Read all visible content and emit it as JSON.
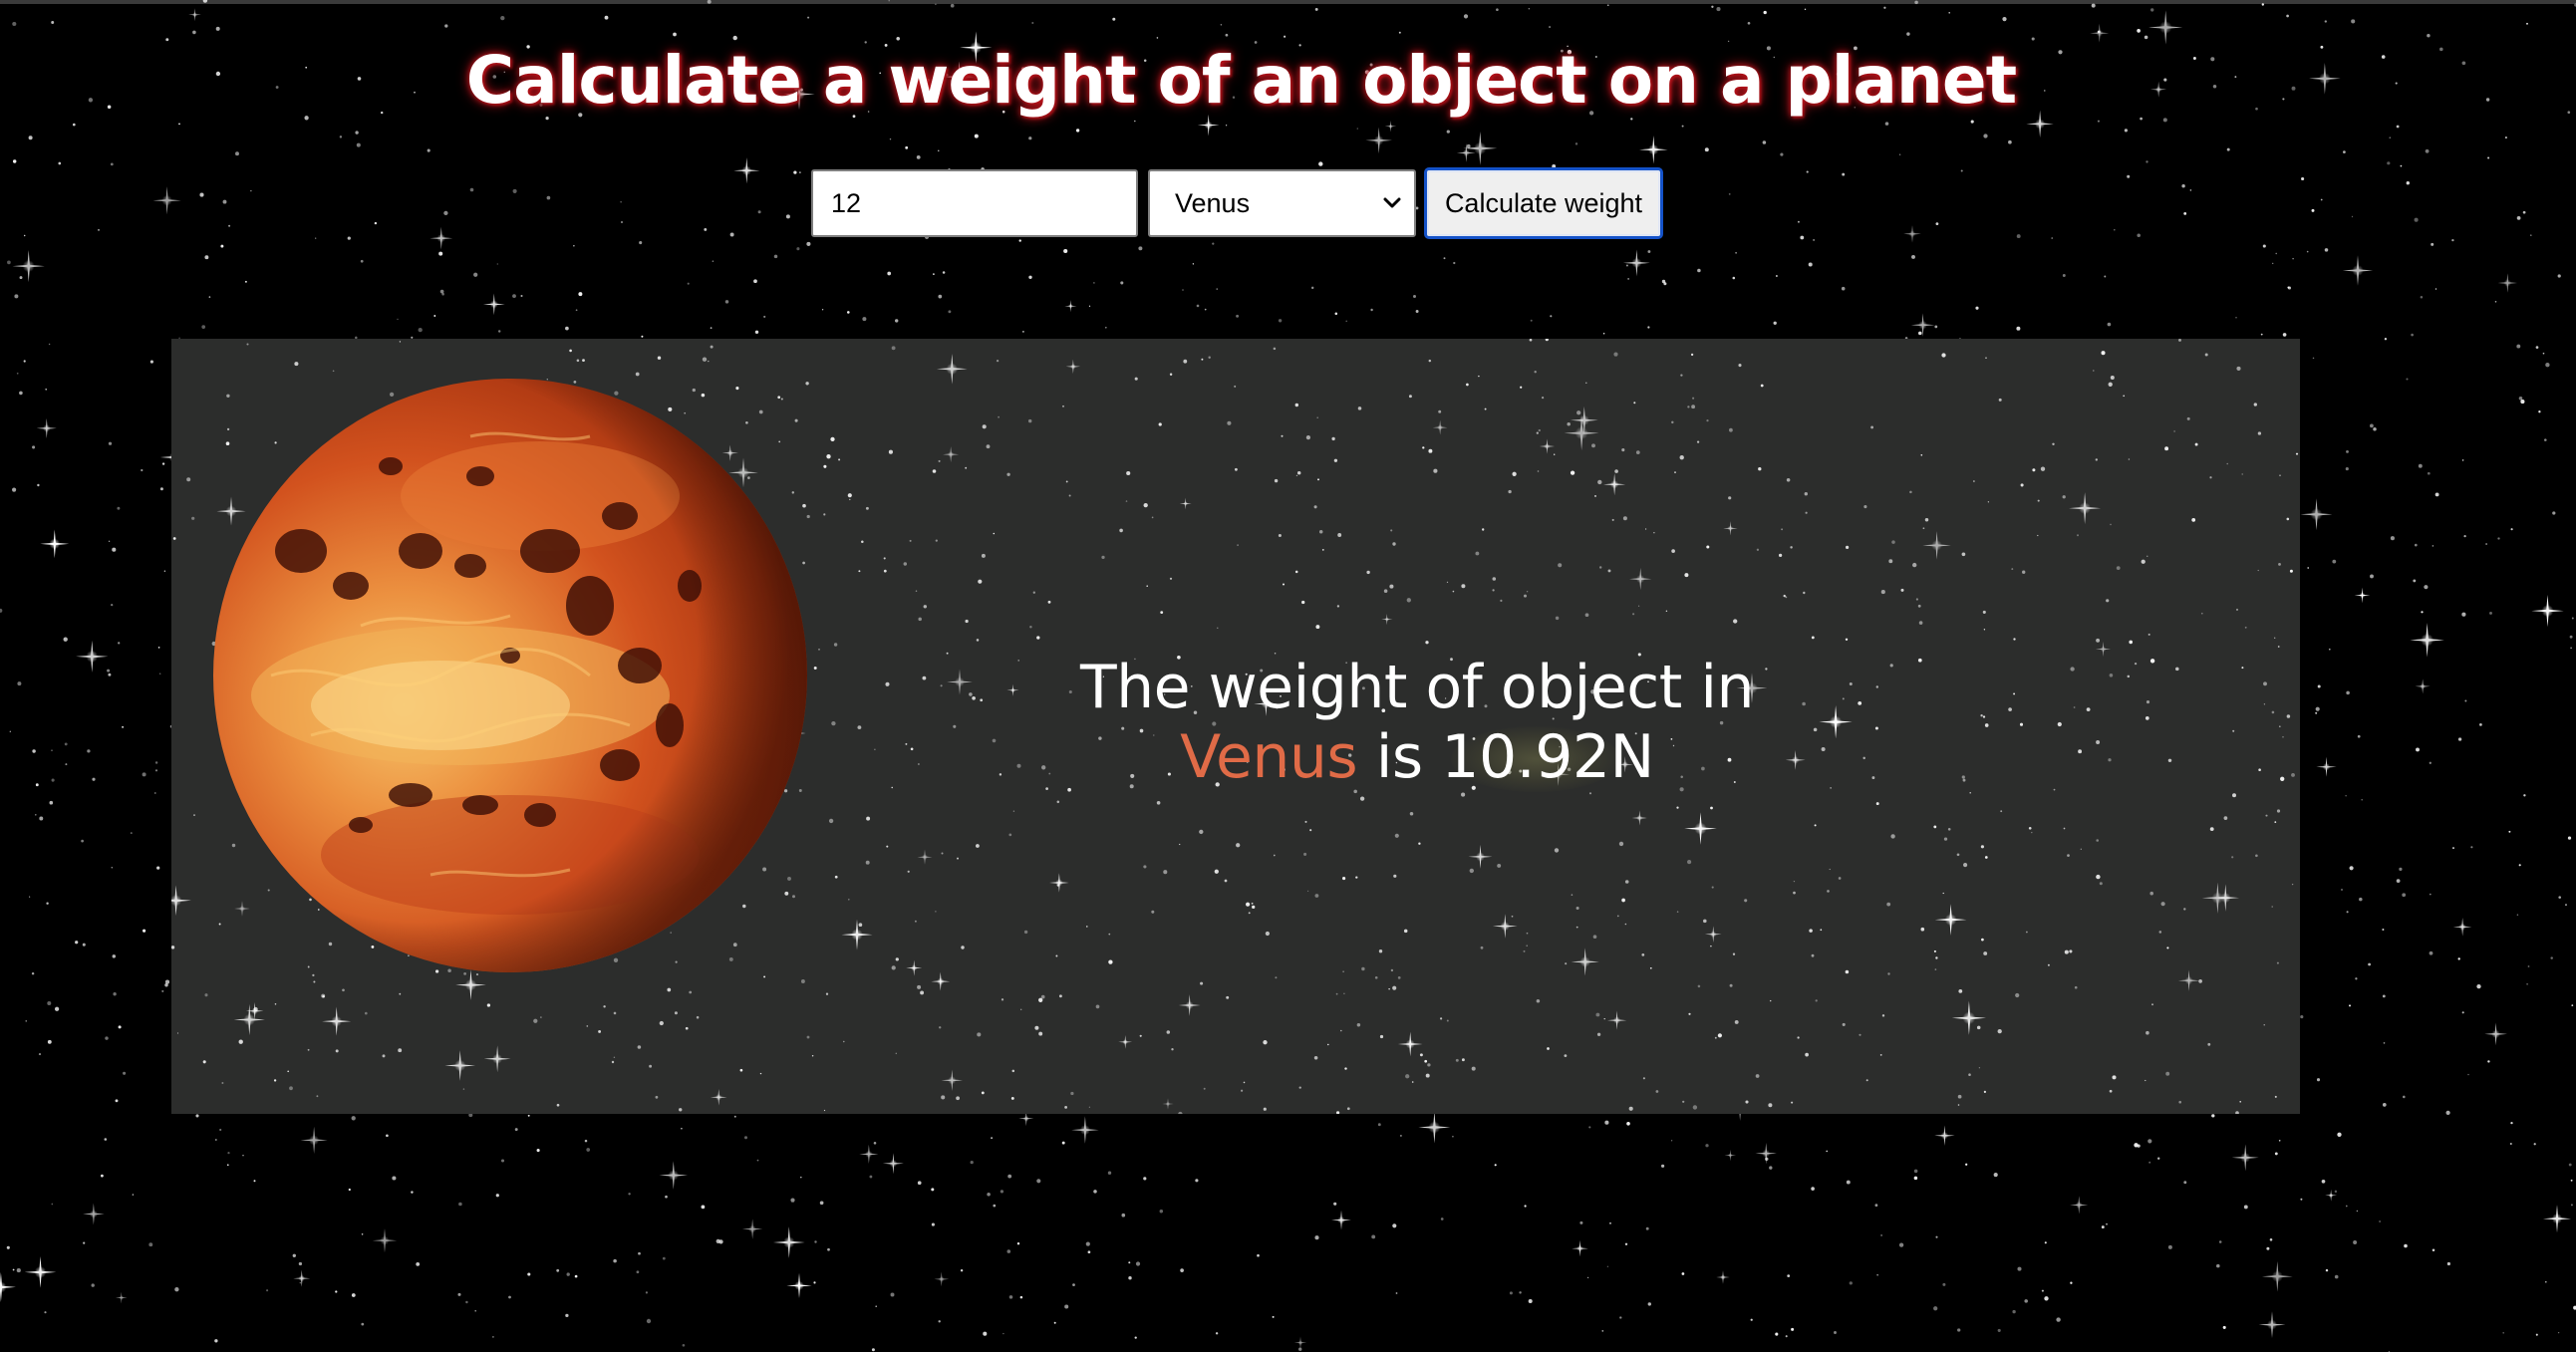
{
  "header": {
    "title": "Calculate a weight of an object on a planet"
  },
  "form": {
    "mass_value": "12",
    "planet_selected": "Venus",
    "submit_label": "Calculate weight"
  },
  "result": {
    "line1": "The weight of object in",
    "planet_name": "Venus",
    "connector": "is",
    "weight": "10.92N"
  },
  "icons": {
    "select_arrow": "chevron-down-icon",
    "planet": "venus-planet-icon"
  },
  "colors": {
    "title_glow": "#c8151e",
    "planet_name": "#e06b47",
    "panel_background": "#2c2d2c",
    "button_focus_border": "#1452c8",
    "planet_surface": "#d2521e"
  }
}
